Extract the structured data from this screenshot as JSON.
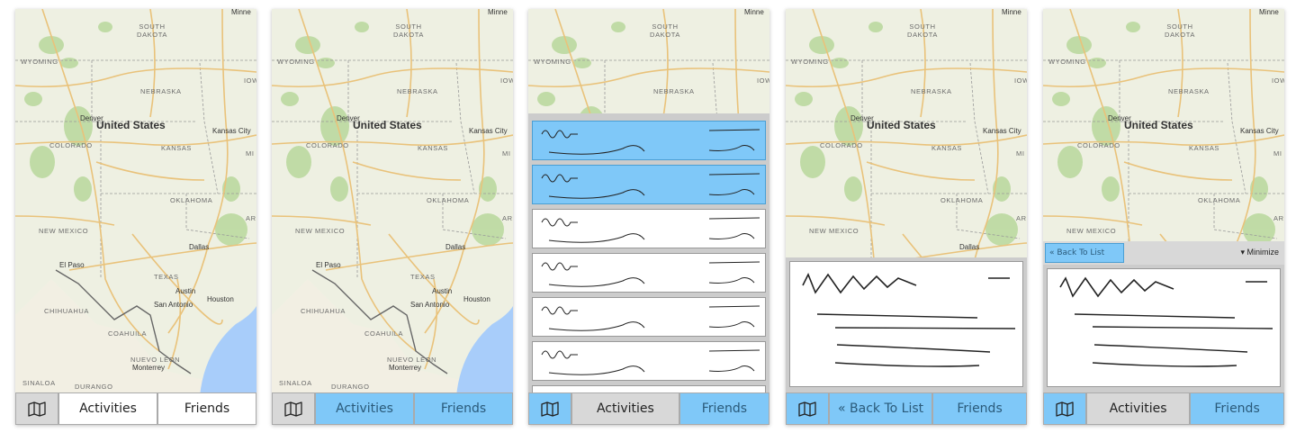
{
  "map_labels": {
    "minnesota_partial": "Minne",
    "south_dakota": "SOUTH DAKOTA",
    "wyoming": "WYOMING",
    "iowa_partial": "IOW",
    "nebraska": "NEBRASKA",
    "denver": "Denver",
    "united_states": "United States",
    "kansas_city": "Kansas City",
    "colorado": "COLORADO",
    "kansas": "KANSAS",
    "missouri_partial": "MI",
    "oklahoma": "OKLAHOMA",
    "arkansas_partial": "AR",
    "new_mexico": "NEW MEXICO",
    "dallas": "Dallas",
    "el_paso": "El Paso",
    "texas": "TEXAS",
    "austin": "Austin",
    "houston": "Houston",
    "san_antonio": "San Antonio",
    "chihuahua": "CHIHUAHUA",
    "coahuila": "COAHUILA",
    "nuevo_leon": "NUEVO LEON",
    "monterrey": "Monterrey",
    "sinaloa": "SINALOA",
    "durango": "DURANGO"
  },
  "tabs": {
    "activities": "Activities",
    "friends": "Friends",
    "back_to_list": "« Back To List"
  },
  "detail_toolbar": {
    "back_to_list": "« Back To List",
    "minimize": "▾ Minimize"
  },
  "icons": {
    "map": "map-icon"
  },
  "colors": {
    "accent_blue": "#7fc8f8",
    "tab_gray": "#d8d8d8",
    "tab_white": "#ffffff"
  }
}
